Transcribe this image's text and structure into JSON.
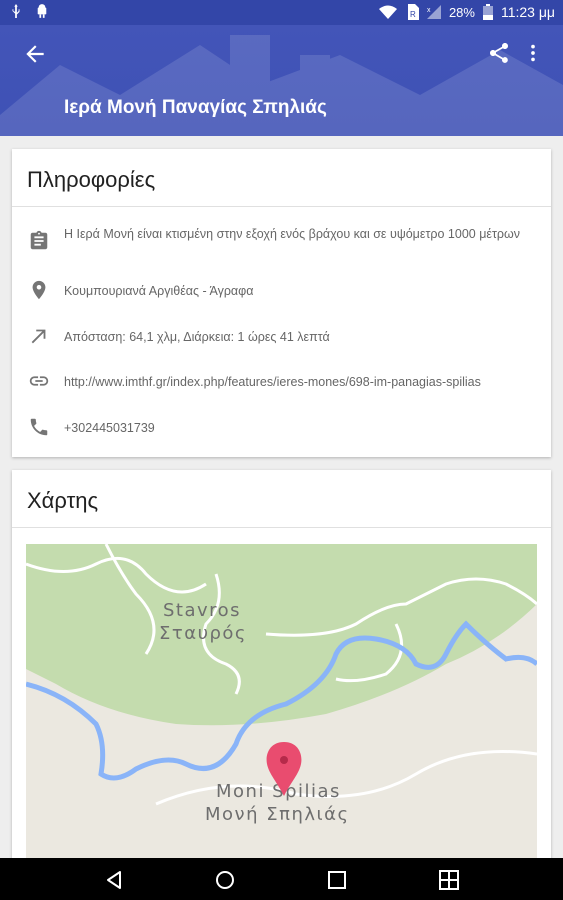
{
  "status_bar": {
    "battery_percent": "28%",
    "time": "11:23 μμ",
    "icons": [
      "usb-icon",
      "android-debug-icon",
      "wifi-icon",
      "sim-icon",
      "signal-icon",
      "battery-icon"
    ]
  },
  "app_bar": {
    "title": "Ιερά Μονή Παναγίας Σπηλιάς",
    "icons": [
      "arrow-back-icon",
      "share-icon",
      "more-vert-icon"
    ]
  },
  "info_card": {
    "header": "Πληροφορίες",
    "rows": [
      {
        "icon": "clipboard-icon",
        "text": "Η Ιερά Μονή είναι κτισμένη στην εξοχή ενός βράχου και σε υψόμετρο 1000 μέτρων"
      },
      {
        "icon": "place-icon",
        "text": "Κουμπουριανά Αργιθέας - Άγραφα"
      },
      {
        "icon": "directions-arrow-icon",
        "text": "Απόσταση: 64,1 χλμ, Διάρκεια: 1 ώρες 41 λεπτά"
      },
      {
        "icon": "link-icon",
        "text": "http://www.imthf.gr/index.php/features/ieres-mones/698-im-panagias-spilias"
      },
      {
        "icon": "phone-icon",
        "text": "+302445031739"
      }
    ]
  },
  "map_card": {
    "header": "Χάρτης",
    "labels": {
      "stavros_latin": "Stavros",
      "stavros_greek": "Σταυρός",
      "moni_latin": "Moni Spilias",
      "moni_greek": "Μονή Σπηλιάς"
    },
    "colors": {
      "forest": "#c4dcae",
      "land": "#ebe8e0",
      "river": "#8ab4f8",
      "pin": "#e94c6f"
    }
  },
  "nav_bar": {
    "icons": [
      "back-triangle-icon",
      "home-circle-icon",
      "recents-square-icon",
      "multiwindow-icon"
    ]
  },
  "colors": {
    "primary": "#3e51b5",
    "status_bar": "#3346a8"
  }
}
